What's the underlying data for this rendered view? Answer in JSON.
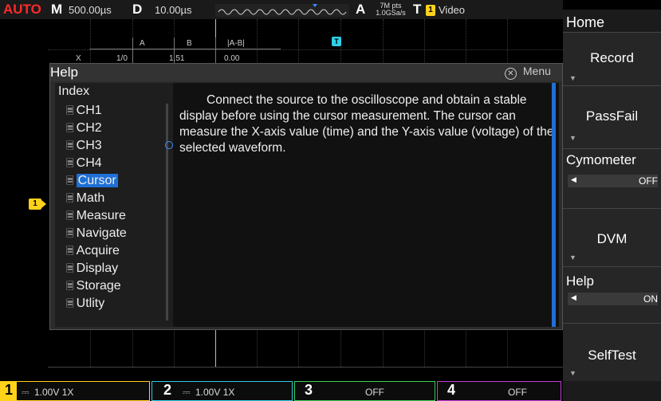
{
  "topbar": {
    "mode": "AUTO",
    "m_label": "M",
    "m_value": "500.00µs",
    "d_label": "D",
    "d_value": "10.00µs",
    "a_label": "A",
    "pts_line1": "7M pts",
    "pts_line2": "1.0GSa/s",
    "t_label": "T",
    "t_channel": "1",
    "t_value": "Video"
  },
  "cursor_table": {
    "headers": [
      "A",
      "B",
      "|A-B|"
    ],
    "row_label": "X",
    "row_values": [
      "1/0",
      "1.51",
      "0.00"
    ]
  },
  "trigger_marker": "T",
  "channel1_marker": "1",
  "help": {
    "title": "Help",
    "close_label": "Menu",
    "index_title": "Index",
    "items": [
      "CH1",
      "CH2",
      "CH3",
      "CH4",
      "Cursor",
      "Math",
      "Measure",
      "Navigate",
      "Acquire",
      "Display",
      "Storage",
      "Utlity"
    ],
    "selected": "Cursor",
    "content": "Connect the source to the oscilloscope and obtain a stable display before using the cursor measurement. The cursor can measure the X-axis value (time) and the Y-axis value (voltage) of the selected waveform."
  },
  "menu": {
    "title": "Home",
    "items": [
      {
        "label": "Record"
      },
      {
        "label": "PassFail"
      },
      {
        "label": "Cymometer",
        "value": "OFF"
      },
      {
        "label": "DVM"
      },
      {
        "label": "Help",
        "value": "ON"
      },
      {
        "label": "SelfTest"
      }
    ]
  },
  "channels": [
    {
      "num": "1",
      "value": "1.00V 1X",
      "color": "#ffd21a"
    },
    {
      "num": "2",
      "value": "1.00V 1X",
      "color": "#2fd0e8"
    },
    {
      "num": "3",
      "value": "OFF",
      "color": "#3bd15a"
    },
    {
      "num": "4",
      "value": "OFF",
      "color": "#c43bd8"
    }
  ],
  "colors": {
    "accent": "#1f6fd6",
    "ch1": "#ffd21a",
    "auto": "#ff2a2a"
  }
}
